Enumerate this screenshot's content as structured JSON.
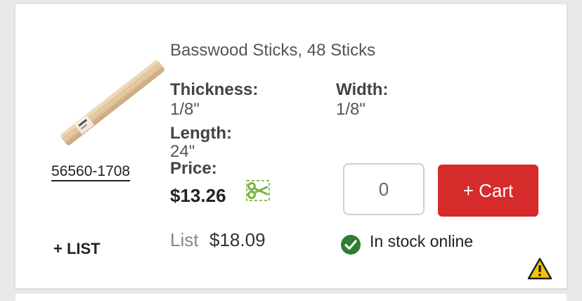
{
  "product": {
    "title": "Basswood Sticks, 48 Sticks",
    "sku": "56560-1708",
    "add_to_list_label": "+ LIST",
    "image_icon": "basswood-stick-image"
  },
  "specs": {
    "thickness_label": "Thickness:",
    "thickness_value": "1/8\"",
    "width_label": "Width:",
    "width_value": "1/8\"",
    "length_label": "Length:",
    "length_value": "24\""
  },
  "pricing": {
    "price_label": "Price:",
    "price_value": "$13.26",
    "coupon_icon": "scissors-coupon-icon",
    "list_label": "List",
    "list_value": "$18.09"
  },
  "cart": {
    "quantity_value": "0",
    "add_button_label": "+ Cart",
    "button_color": "#d52b2b"
  },
  "stock": {
    "status_text": "In stock online",
    "status_icon": "check-circle-icon",
    "status_color": "#2e7d32"
  },
  "warning": {
    "icon": "warning-icon",
    "color": "#f5c400"
  }
}
